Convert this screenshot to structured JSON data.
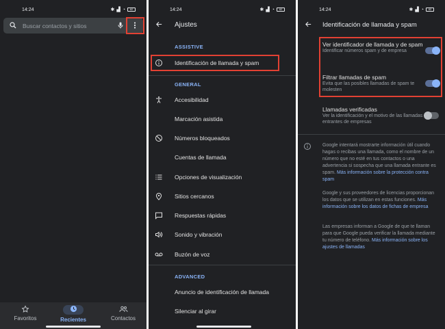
{
  "status": {
    "time": "14:24",
    "battery": "82"
  },
  "dialer": {
    "search_placeholder": "Buscar contactos y sitios",
    "nav": [
      {
        "label": "Favoritos",
        "icon": "star-icon"
      },
      {
        "label": "Recientes",
        "icon": "clock-icon"
      },
      {
        "label": "Contactos",
        "icon": "people-icon"
      }
    ]
  },
  "settings": {
    "title": "Ajustes",
    "sections": [
      {
        "header": "ASSISTIVE",
        "items": [
          {
            "label": "Identificación de llamada y spam",
            "icon": "info-icon"
          }
        ]
      },
      {
        "header": "GENERAL",
        "items": [
          {
            "label": "Accesibilidad",
            "icon": "accessibility-icon"
          },
          {
            "label": "Marcación asistida",
            "icon": ""
          },
          {
            "label": "Números bloqueados",
            "icon": "block-icon"
          },
          {
            "label": "Cuentas de llamada",
            "icon": ""
          },
          {
            "label": "Opciones de visualización",
            "icon": "list-icon"
          },
          {
            "label": "Sitios cercanos",
            "icon": "location-pin-icon"
          },
          {
            "label": "Respuestas rápidas",
            "icon": "message-icon"
          },
          {
            "label": "Sonido y vibración",
            "icon": "volume-icon"
          },
          {
            "label": "Buzón de voz",
            "icon": "voicemail-icon"
          }
        ]
      },
      {
        "header": "ADVANCED",
        "items": [
          {
            "label": "Anuncio de identificación de llamada",
            "icon": ""
          },
          {
            "label": "Silenciar al girar",
            "icon": ""
          }
        ]
      }
    ]
  },
  "caller_id": {
    "title": "Identificación de llamada y spam",
    "toggles": [
      {
        "title": "Ver identificador de llamada y de spam",
        "desc": "Identificar números spam y de empresa",
        "on": true
      },
      {
        "title": "Filtrar llamadas de spam",
        "desc": "Evita que las posibles llamadas de spam te molesten",
        "on": true
      },
      {
        "title": "Llamadas verificadas",
        "desc": "Ver la identificación y el motivo de las llamadas entrantes de empresas",
        "on": false
      }
    ],
    "info": [
      {
        "text": "Google intentará mostrarte información útil cuando hagas o recibas una llamada, como el nombre de un número que no esté en tus contactos o una advertencia si sospecha que una llamada entrante es spam. ",
        "link": "Más información sobre la protección contra spam"
      },
      {
        "text": "Google y sus proveedores de licencias proporcionan los datos que se utilizan en estas funciones. ",
        "link": "Más información sobre los datos de fichas de empresa"
      },
      {
        "text": "Las empresas informan a Google de que te llaman para que Google pueda verificar la llamada mediante tu número de teléfono. ",
        "link": "Más información sobre los ajustes de llamadas"
      }
    ]
  },
  "colors": {
    "background": "#202124",
    "accent": "#8ab4f8",
    "highlight": "#e34133"
  }
}
